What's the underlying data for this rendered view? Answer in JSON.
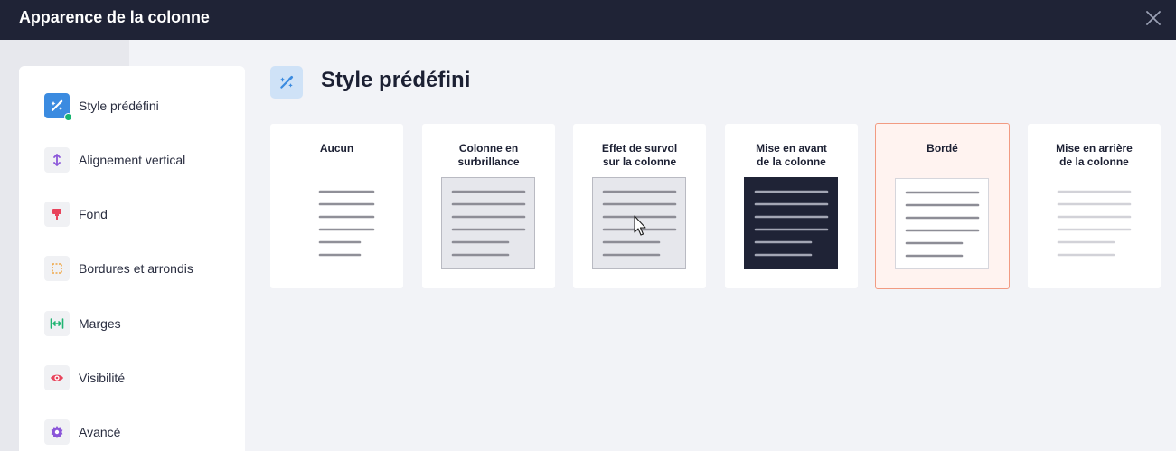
{
  "dialog": {
    "title": "Apparence de la colonne",
    "close_icon": "close-icon"
  },
  "sidebar": {
    "items": [
      {
        "label": "Style prédéfini",
        "icon": "magic-wand-icon",
        "active": true
      },
      {
        "label": "Alignement vertical",
        "icon": "vertical-align-icon"
      },
      {
        "label": "Fond",
        "icon": "paint-roller-icon"
      },
      {
        "label": "Bordures et arrondis",
        "icon": "border-dashed-icon"
      },
      {
        "label": "Marges",
        "icon": "margins-icon"
      },
      {
        "label": "Visibilité",
        "icon": "eye-icon"
      },
      {
        "label": "Avancé",
        "icon": "gear-icon"
      }
    ]
  },
  "main": {
    "title": "Style prédéfini",
    "header_icon": "magic-wand-icon",
    "presets": [
      {
        "label": "Aucun"
      },
      {
        "label": "Colonne en\nsurbrillance"
      },
      {
        "label": "Effet de survol\nsur la colonne"
      },
      {
        "label": "Mise en avant\nde la colonne"
      },
      {
        "label": "Bordé",
        "selected": true
      },
      {
        "label": "Mise en arrière\nde la colonne"
      }
    ]
  },
  "colors": {
    "titlebar": "#1f2336",
    "accent_blue": "#3b8be0",
    "selected_border": "#f29b82",
    "status_green": "#17b471"
  }
}
